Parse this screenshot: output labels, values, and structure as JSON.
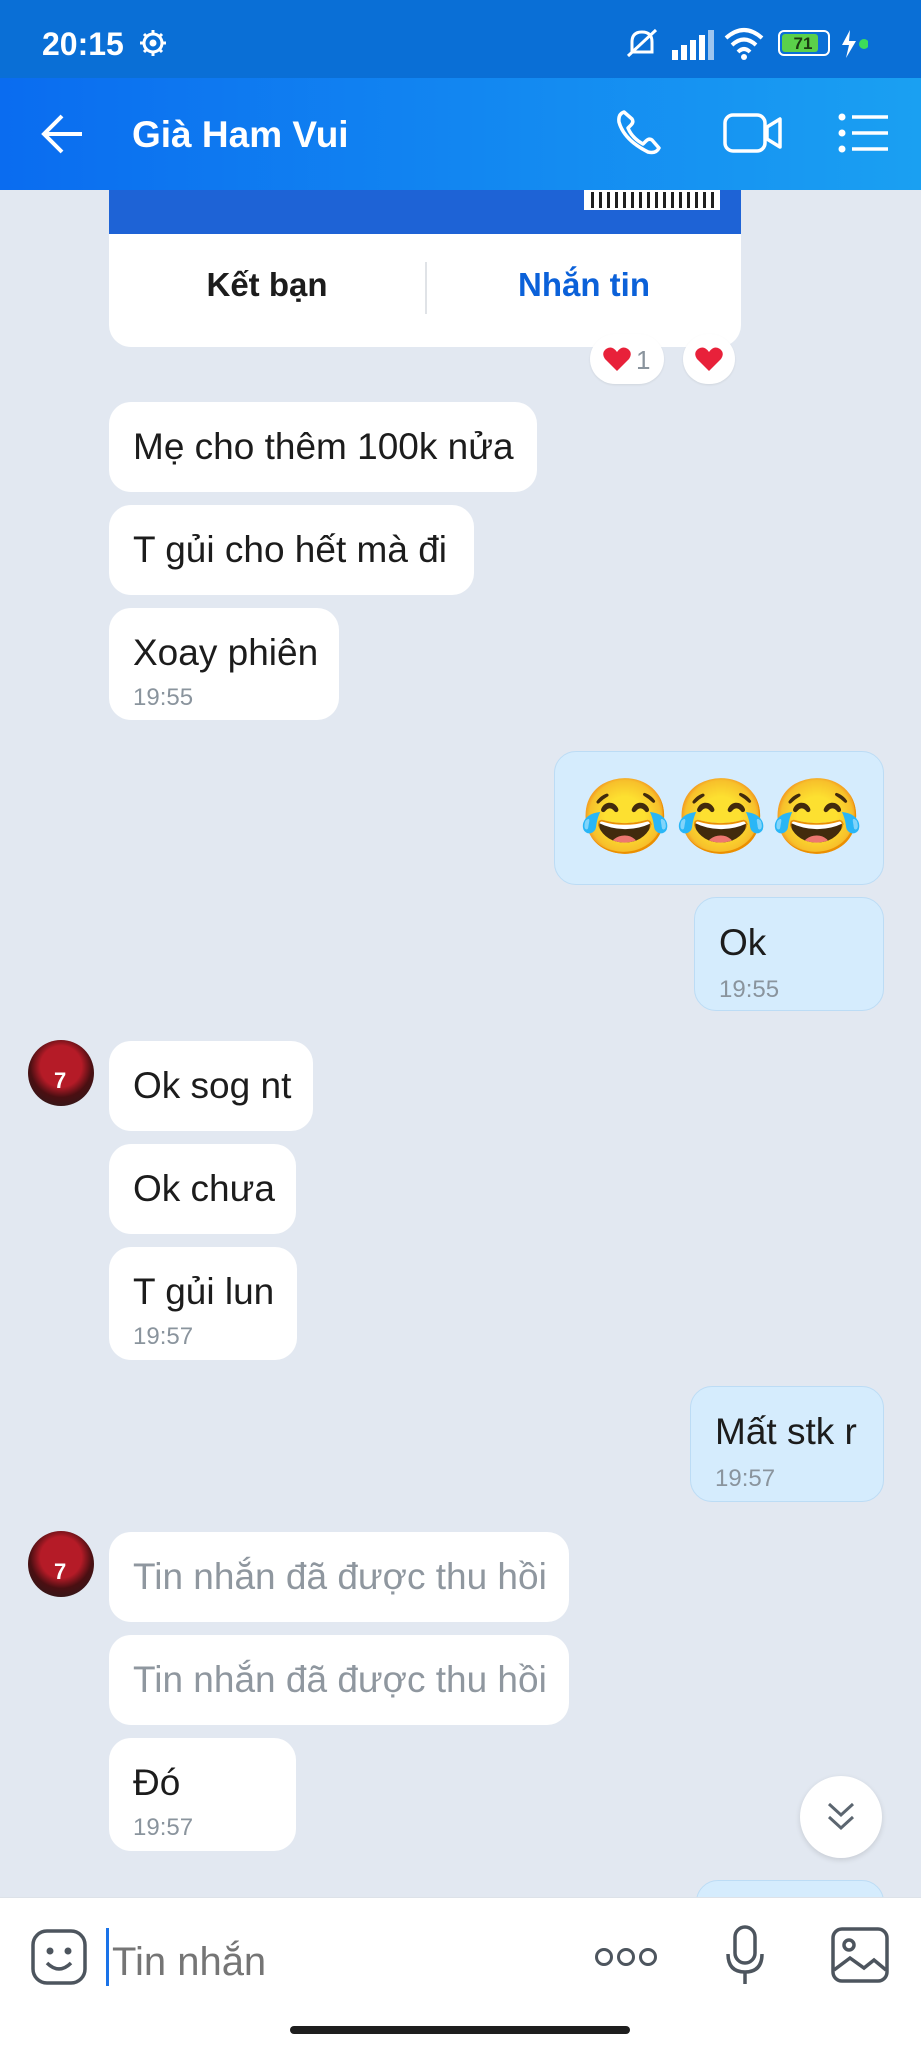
{
  "status": {
    "time": "20:15",
    "battery": "71"
  },
  "header": {
    "title": "Già Ham Vui"
  },
  "card": {
    "add_friend": "Kết bạn",
    "message": "Nhắn tin",
    "reaction_count": "1"
  },
  "messages": [
    {
      "text": "Mẹ cho thêm 100k nửa"
    },
    {
      "text": "T gủi cho hết mà đi"
    },
    {
      "text": "Xoay phiên",
      "time": "19:55"
    },
    {
      "text": "😂😂😂"
    },
    {
      "text": "Ok",
      "time": "19:55"
    },
    {
      "text": "Ok sog nt"
    },
    {
      "text": "Ok chưa"
    },
    {
      "text": "T gủi lun",
      "time": "19:57"
    },
    {
      "text": "Mất stk r",
      "time": "19:57"
    },
    {
      "text": "Tin nhắn đã được thu hồi"
    },
    {
      "text": "Tin nhắn đã được thu hồi"
    },
    {
      "text": "Đó",
      "time": "19:57"
    }
  ],
  "input": {
    "placeholder": "Tin nhắn"
  },
  "colors": {
    "header": "#0a6cf0",
    "incoming": "#ffffff",
    "outgoing": "#d5ecfd",
    "background": "#e2e8f1",
    "link": "#0b61d9"
  },
  "icons": [
    "settings-icon",
    "mute-icon",
    "signal-icon",
    "wifi-icon",
    "battery-icon",
    "back-arrow-icon",
    "phone-icon",
    "video-call-icon",
    "menu-list-icon",
    "heart-icon",
    "chevron-double-down-icon",
    "sticker-icon",
    "more-icon",
    "microphone-icon",
    "image-icon"
  ]
}
